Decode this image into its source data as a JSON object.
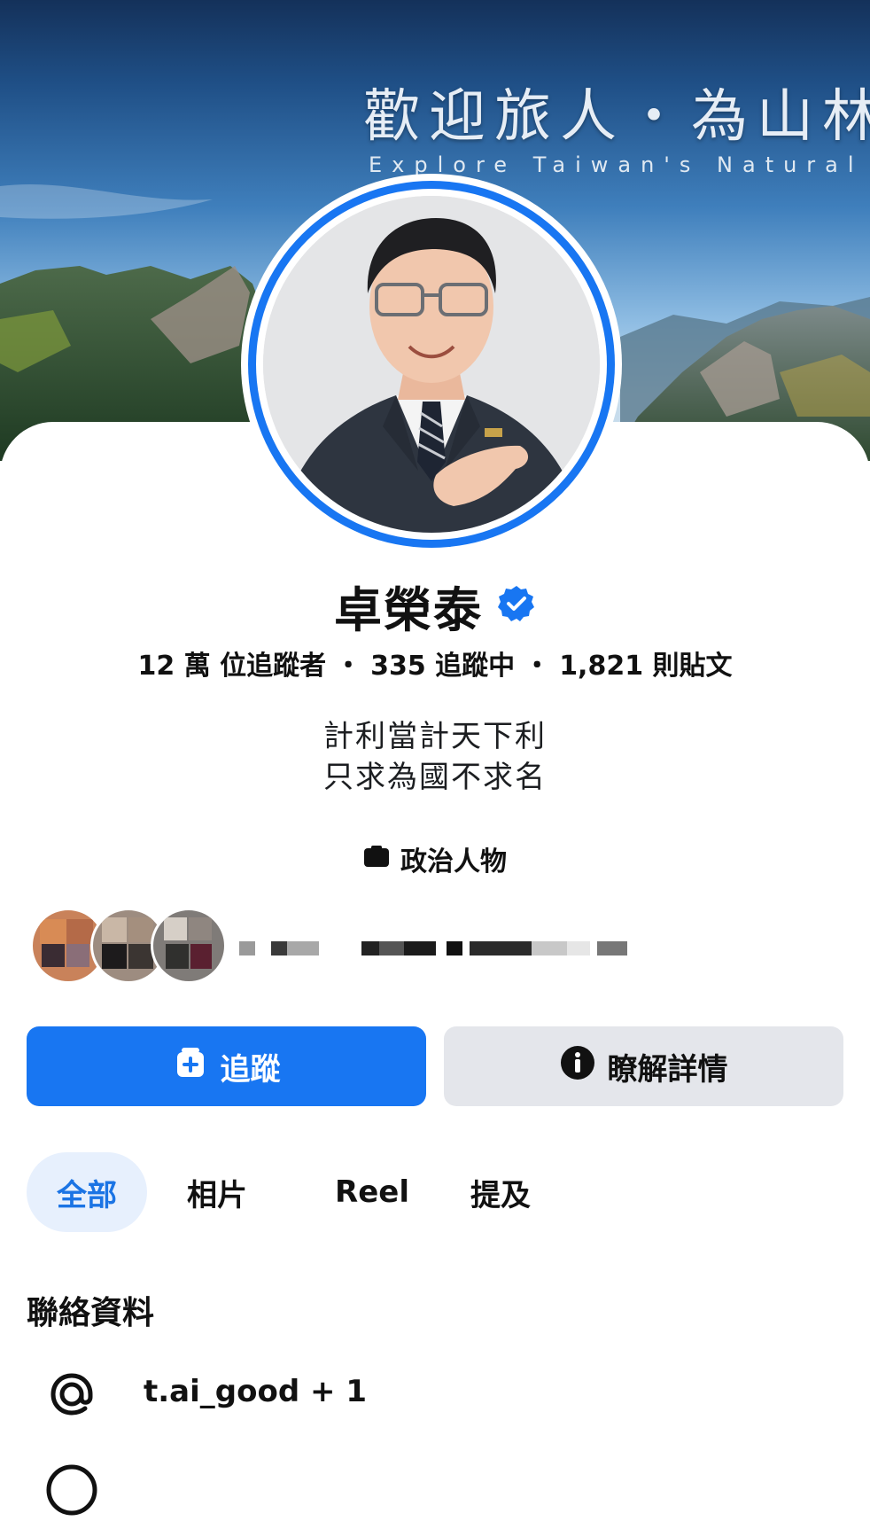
{
  "cover": {
    "title": "歡迎旅人・為山林而",
    "subtitle": "Explore Taiwan's Natural Be"
  },
  "profile": {
    "name": "卓榮泰",
    "verified": true,
    "stats": {
      "followers": "12 萬 位追蹤者",
      "following": "335 追蹤中",
      "posts": "1,821 則貼文",
      "separator": "・"
    },
    "bio_line1": "計利當計天下利",
    "bio_line2": "只求為國不求名",
    "category": "政治人物"
  },
  "actions": {
    "follow_label": "追蹤",
    "info_label": "瞭解詳情"
  },
  "tabs": [
    {
      "label": "全部",
      "active": true
    },
    {
      "label": "相片",
      "active": false
    },
    {
      "label": "Reel",
      "active": false
    },
    {
      "label": "提及",
      "active": false
    }
  ],
  "contact": {
    "title": "聯絡資料",
    "instagram": "t.ai_good + 1"
  },
  "colors": {
    "accent": "#1876f2",
    "secondary_button": "#e4e6eb",
    "active_tab_bg": "#e7f0fd",
    "active_tab_text": "#1b74e4"
  },
  "icons": {
    "verified": "verified-badge-icon",
    "category": "category-icon",
    "follow": "follow-add-icon",
    "info": "info-icon",
    "contact": "at-sign-icon"
  }
}
